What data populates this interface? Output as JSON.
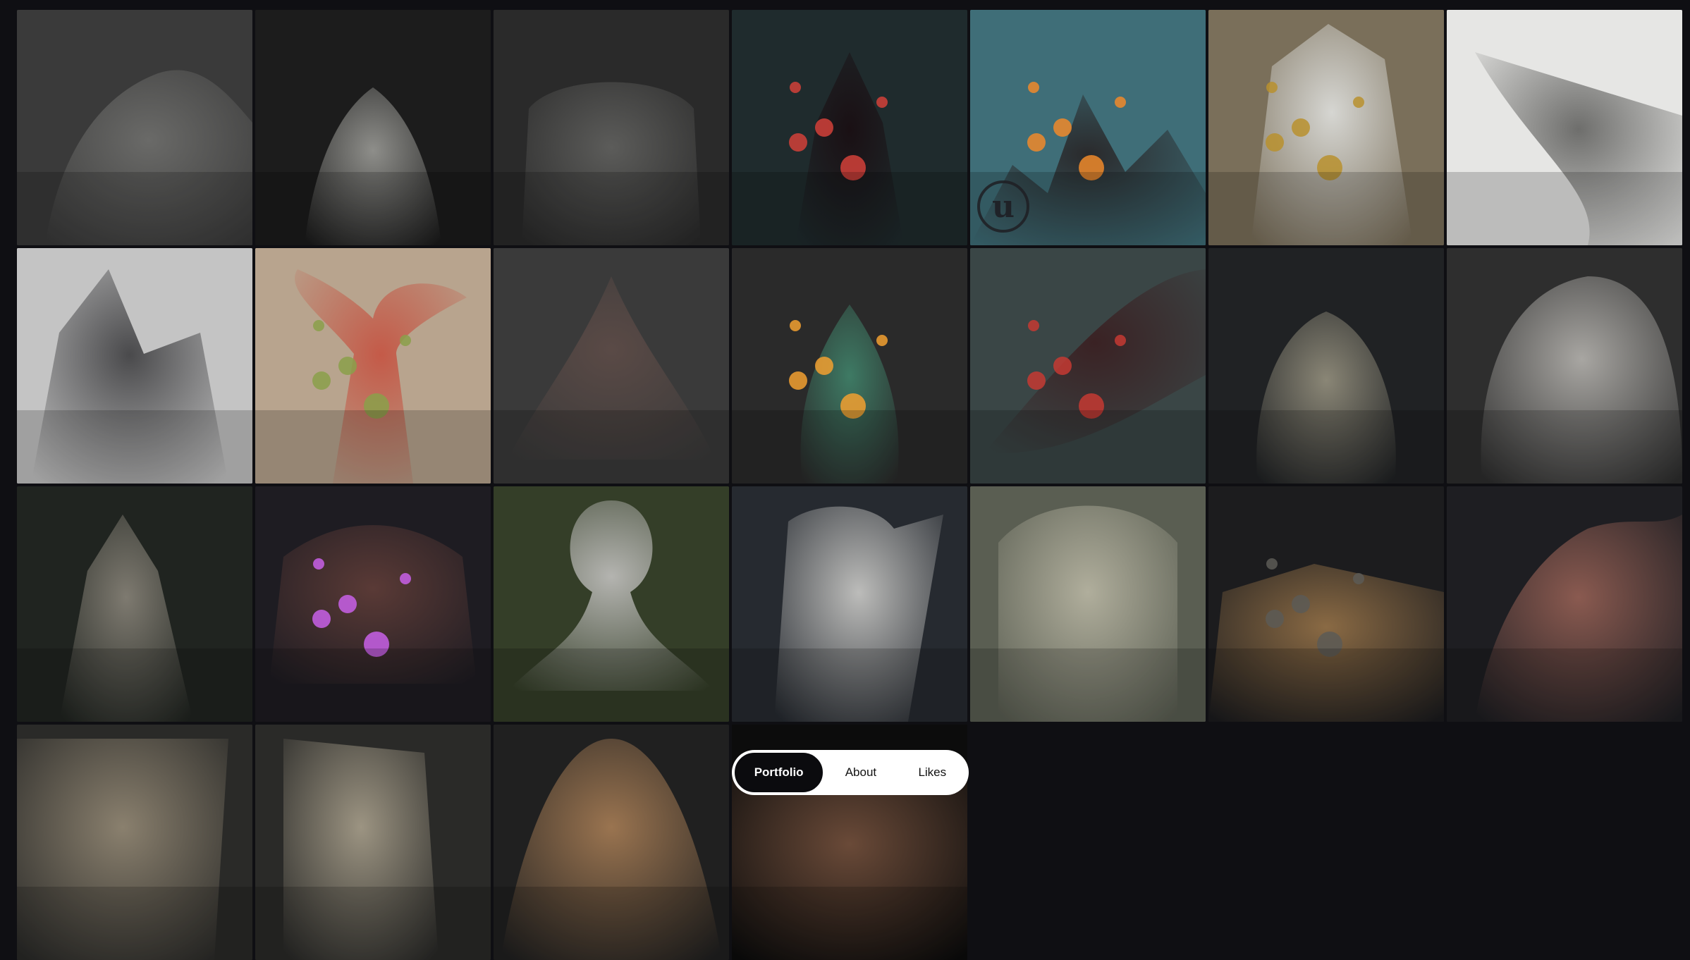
{
  "gallery": {
    "tiles": [
      {
        "name": "tile-sculpt-fabric-face",
        "bg": "#3a3a3a",
        "fg": "#6a6a68"
      },
      {
        "name": "tile-horned-tree-ent",
        "bg": "#1c1c1c",
        "fg": "#8e8e8a"
      },
      {
        "name": "tile-stone-golem",
        "bg": "#2a2a2a",
        "fg": "#5c5c5a"
      },
      {
        "name": "tile-red-crystal",
        "bg": "#1f2b2d",
        "fg": "#1a1014",
        "accent": "#d2413a"
      },
      {
        "name": "tile-volcano-stairs",
        "bg": "#3f6e78",
        "fg": "#2a2a2c",
        "accent": "#f08a2a",
        "badge": "u"
      },
      {
        "name": "tile-chained-rock",
        "bg": "#7a6f5a",
        "fg": "#d6d6d2",
        "accent": "#b8902e"
      },
      {
        "name": "tile-stone-slab",
        "bg": "#e6e6e4",
        "fg": "#6e6e6c"
      },
      {
        "name": "tile-gray-cliff",
        "bg": "#c4c4c4",
        "fg": "#4a4a4c"
      },
      {
        "name": "tile-red-palm",
        "bg": "#b8a48e",
        "fg": "#c45a48",
        "accent": "#8aa04a"
      },
      {
        "name": "tile-dark-crystals",
        "bg": "#3a3a3a",
        "fg": "#5a4a46"
      },
      {
        "name": "tile-jade-lantern",
        "bg": "#2a2a2a",
        "fg": "#3e7a64",
        "accent": "#f2a030"
      },
      {
        "name": "tile-red-fish",
        "bg": "#3a4646",
        "fg": "#3a2224",
        "accent": "#c63a32"
      },
      {
        "name": "tile-tree-dwarf",
        "bg": "#202224",
        "fg": "#8a8676"
      },
      {
        "name": "tile-old-man-glasses",
        "bg": "#2e2e2e",
        "fg": "#a8a6a2"
      },
      {
        "name": "tile-priest-figure",
        "bg": "#202420",
        "fg": "#7e7a70"
      },
      {
        "name": "tile-purple-chest",
        "bg": "#1e1c22",
        "fg": "#5a3a36",
        "accent": "#c860e8"
      },
      {
        "name": "tile-mushroom-creature",
        "bg": "#343e28",
        "fg": "#b4b4b0"
      },
      {
        "name": "tile-tree-stump",
        "bg": "#262a30",
        "fg": "#bcbcba"
      },
      {
        "name": "tile-carved-door",
        "bg": "#5a5e52",
        "fg": "#b0ae9c"
      },
      {
        "name": "tile-barrels-well",
        "bg": "#1c1c1e",
        "fg": "#8a6a44",
        "accent": "#5c5a56"
      },
      {
        "name": "tile-red-rock",
        "bg": "#1e1e22",
        "fg": "#8a5a50"
      },
      {
        "name": "tile-cobblestone-wall",
        "bg": "#2a2a28",
        "fg": "#8a806e"
      },
      {
        "name": "tile-wavy-panel",
        "bg": "#2a2a28",
        "fg": "#9c9482"
      },
      {
        "name": "tile-stone-dome",
        "bg": "#202020",
        "fg": "#9a7450"
      },
      {
        "name": "tile-dark-partial",
        "bg": "#0c0c0c",
        "fg": "#6a4a38"
      }
    ]
  },
  "tabs": {
    "portfolio": "Portfolio",
    "about": "About",
    "likes": "Likes"
  }
}
